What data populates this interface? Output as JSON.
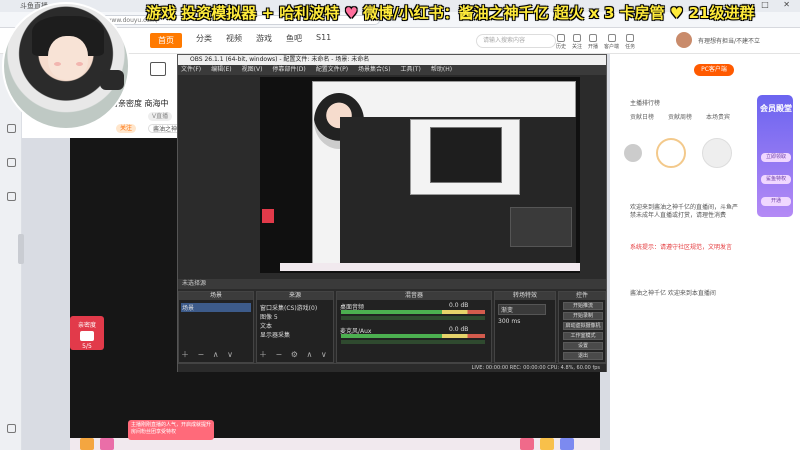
{
  "browser": {
    "tab_title": "斗鱼直播",
    "window_controls": "─ □ ✕",
    "url": "https://www.douyu.com/"
  },
  "site": {
    "nav": [
      "首页",
      "分类",
      "视频",
      "游戏",
      "鱼吧",
      "S11"
    ],
    "active_nav": 0,
    "search_placeholder": "请输入搜索内容",
    "header_icons": [
      "历史",
      "关注",
      "开播",
      "客户端",
      "任务"
    ],
    "user_name": "有理想有担当/不建不立"
  },
  "banner": {
    "a": "游戏 投资模拟器 + 哈利波特",
    "b": "♥",
    "c": "微博/小红书：酱油之神千亿",
    "d": "超火 x 3 卡房管",
    "e": "♥ 21级进群"
  },
  "room": {
    "streamer_line": "捞亲密度  商海中",
    "tags": [
      "关注",
      "酱油之神千亿",
      "V直播",
      "新人热推"
    ],
    "fan_box": {
      "title": "亲密度",
      "count": "5/5"
    },
    "toast_text": "主播刚刚直播的人气，开启成就提升房间粉丝团享受特权"
  },
  "obs": {
    "title": "OBS 26.1.1 (64-bit, windows) - 配置文件: 未命名 - 场景: 未命名",
    "menu": [
      "文件(F)",
      "编辑(E)",
      "视图(V)",
      "停靠部件(D)",
      "配置文件(P)",
      "场景集合(S)",
      "工具(T)",
      "帮助(H)"
    ],
    "source_hint": "未选择源",
    "docks": {
      "scenes": {
        "title": "场景",
        "items": [
          "场景"
        ]
      },
      "sources": {
        "title": "来源",
        "items": [
          "窗口采集(CS)游戏(0)",
          "图像 5",
          "文本",
          "显示器采集"
        ]
      },
      "mixer": {
        "title": "混音器",
        "channels": [
          {
            "name": "桌面音频",
            "level": "0.0 dB"
          },
          {
            "name": "麦克风/Aux",
            "level": "0.0 dB"
          }
        ]
      },
      "transitions": {
        "title": "转场特效",
        "value": "渐变",
        "duration": "300 ms"
      },
      "controls": {
        "title": "控件",
        "buttons": [
          "开始推流",
          "开始录制",
          "启动虚拟摄像机",
          "工作室模式",
          "设置",
          "退出"
        ]
      }
    },
    "status": "LIVE: 00:00:00   REC: 00:00:00   CPU: 4.8%, 60.00 fps"
  },
  "right_panel": {
    "tabs": [
      "贡献日榜",
      "贡献周榜",
      "本场贵宾"
    ],
    "ranking_label": "主播排行榜",
    "chat": [
      {
        "text": "欢迎来到酱油之神千亿的直播间，斗鱼严禁未成年人直播或打赏，请理性消费",
        "hl": false
      },
      {
        "text": "系统提示：请遵守社区规范，文明发言",
        "hl": true
      },
      {
        "text": "酱油之神千亿 欢迎来到本直播间",
        "hl": false
      }
    ],
    "promo": {
      "title": "会员殿堂",
      "buttons": [
        "立即领取",
        "鲨鱼特权",
        "开通"
      ]
    },
    "btn_label": "PC客户端"
  }
}
